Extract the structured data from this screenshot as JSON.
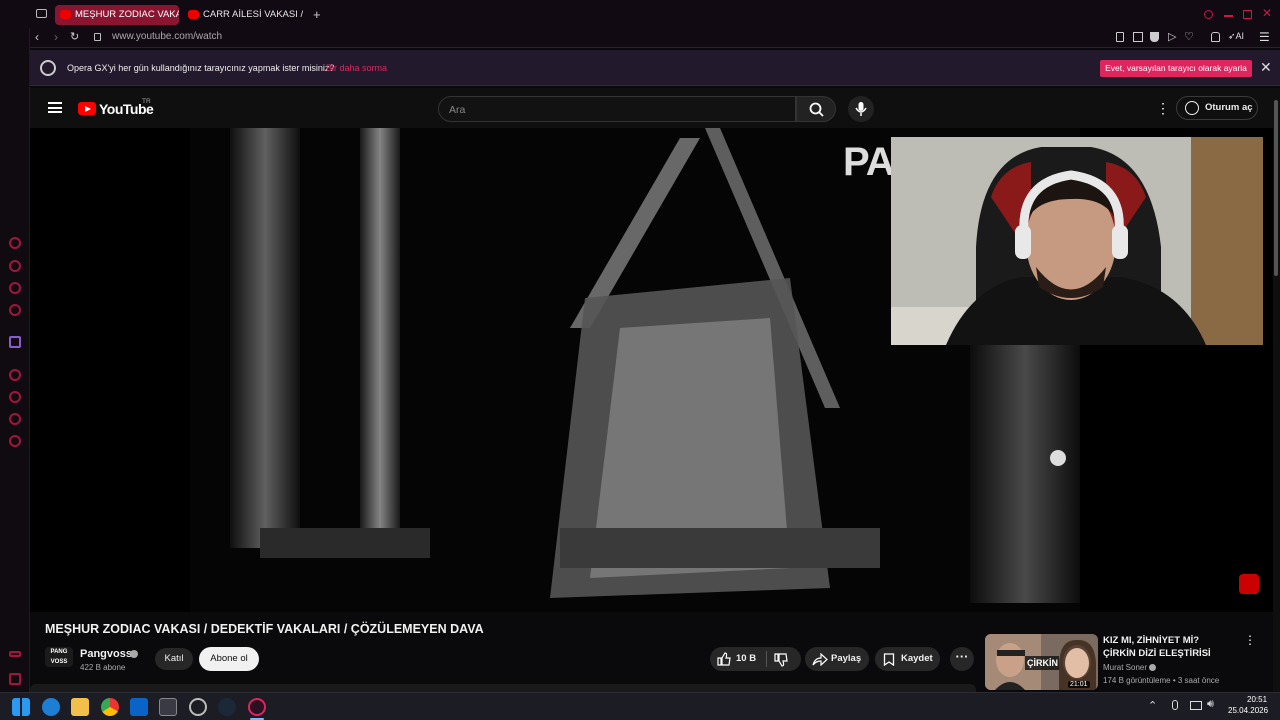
{
  "browser": {
    "tabs": [
      {
        "label": "MEŞHUR ZODIAC VAKASI",
        "active": true
      },
      {
        "label": "CARR AİLESİ VAKASI / DE",
        "active": false
      }
    ],
    "new_tab": "+",
    "url": "www.youtube.com/watch",
    "ai_label": "AI"
  },
  "banner": {
    "text": "Opera GX'yi her gün kullandığınız tarayıcınız yapmak ister misiniz?",
    "link": "Bir daha sorma",
    "button": "Evet, varsayılan tarayıcı olarak ayarla",
    "close": "✕"
  },
  "youtube": {
    "logo": "YouTube",
    "country": "TR",
    "search_placeholder": "Ara",
    "signin": "Oturum aç"
  },
  "video": {
    "overlay_text": "PA",
    "title": "MEŞHUR ZODIAC VAKASI / DEDEKTİF VAKALARI / ÇÖZÜLEMEYEN DAVA",
    "channel": "Pangvoss",
    "channel_avatar_text": "PANG VOSS",
    "subscribers": "422 B abone",
    "join": "Katıl",
    "subscribe": "Abone ol",
    "likes": "10 B",
    "share": "Paylaş",
    "save": "Kaydet"
  },
  "recommendation": {
    "title": "KIZ MI, ZİHNİYET Mİ? ÇİRKİN DİZİ ELEŞTİRİSİ",
    "channel": "Murat Soner",
    "meta": "174 B görüntüleme • 3 saat önce",
    "duration": "21:01",
    "thumb_text": "ÇİRKİN"
  },
  "taskbar": {
    "time": "20:51",
    "date": "25.04.2026"
  },
  "colors": {
    "opera_accent": "#e0245e",
    "youtube_red": "#ff0000"
  }
}
